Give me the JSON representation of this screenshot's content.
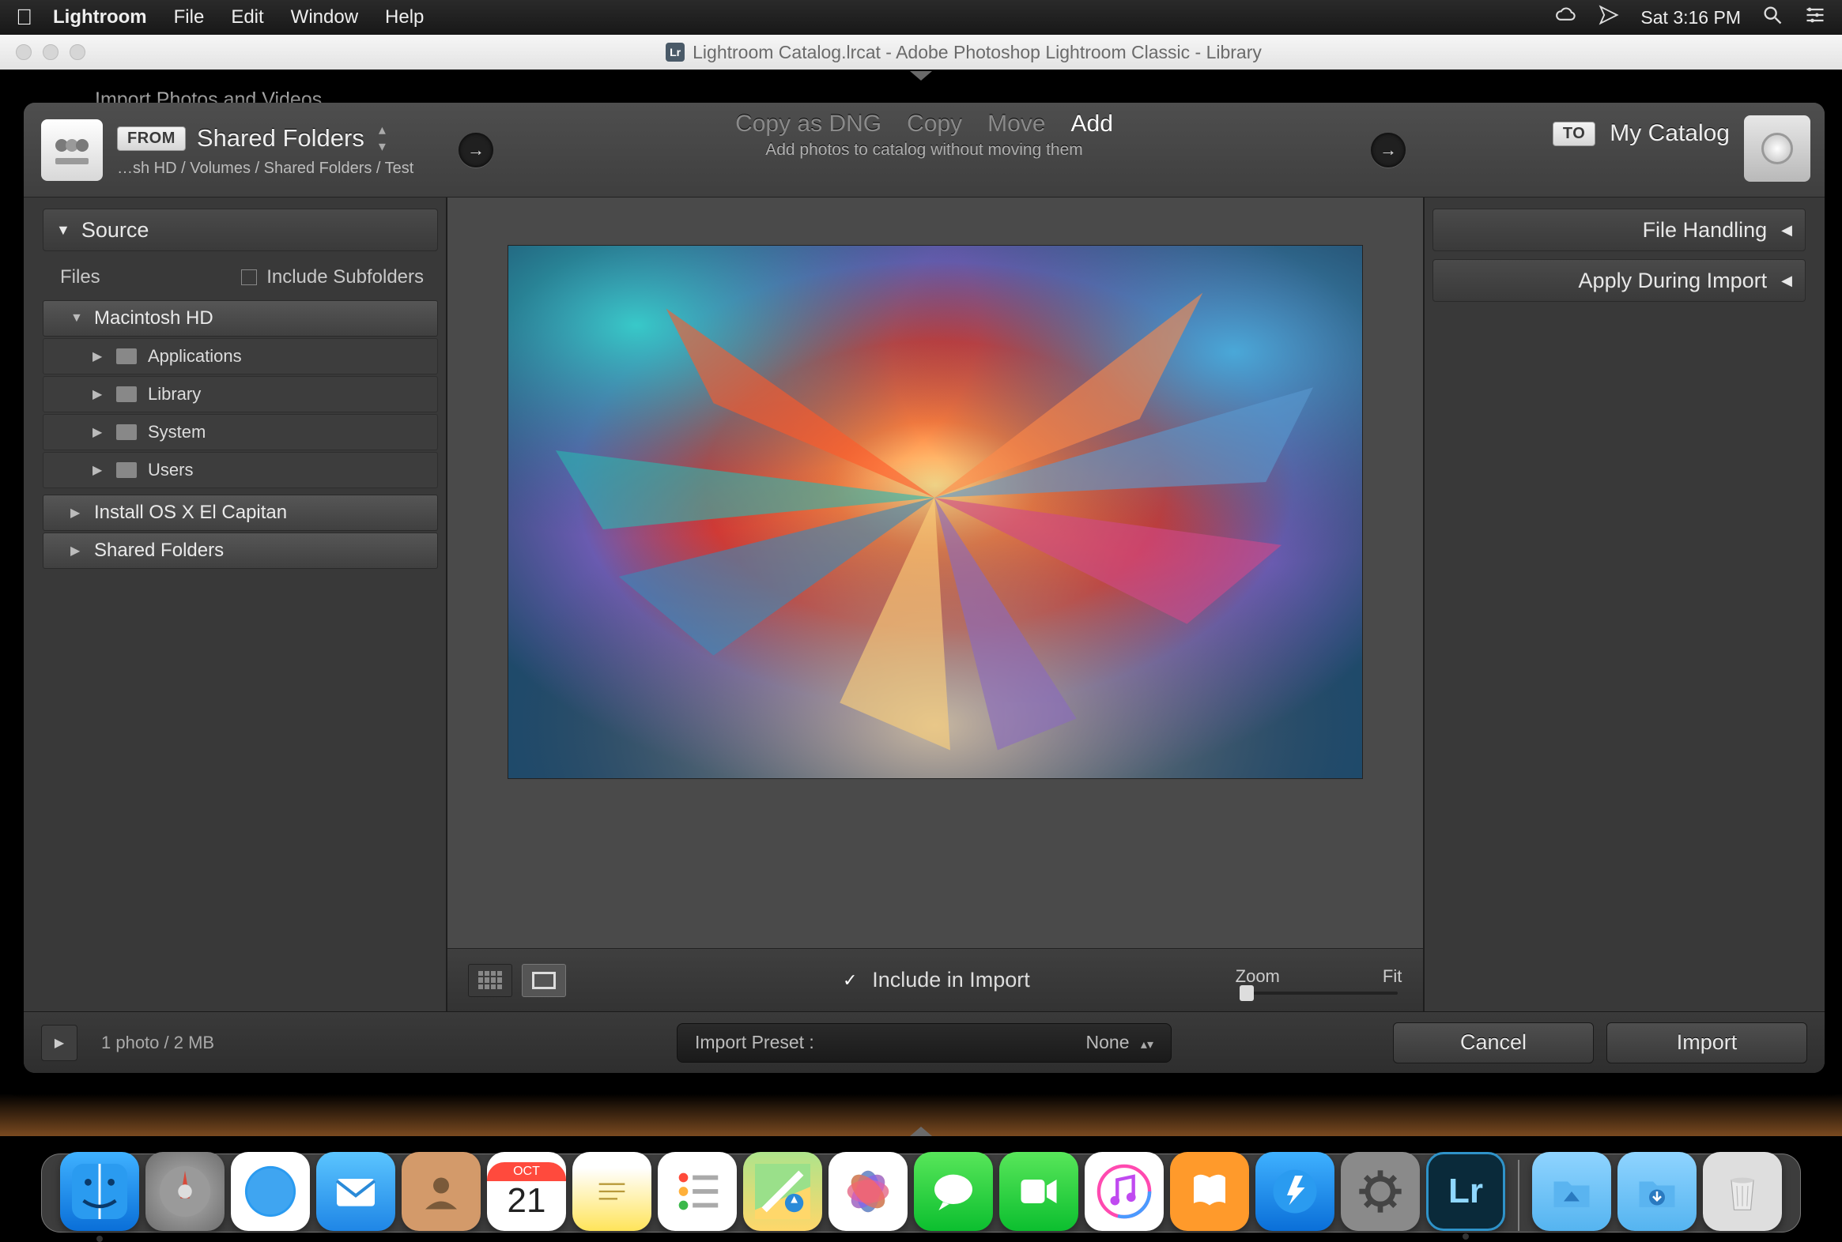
{
  "menubar": {
    "app": "Lightroom",
    "items": [
      "File",
      "Edit",
      "Window",
      "Help"
    ],
    "clock": "Sat 3:16 PM"
  },
  "titlebar": {
    "title": "Lightroom Catalog.lrcat - Adobe Photoshop Lightroom Classic - Library"
  },
  "hidden": "Import Photos and Videos",
  "import": {
    "from_badge": "FROM",
    "from_title": "Shared Folders",
    "from_path": "…sh HD / Volumes / Shared Folders / Test",
    "ops": [
      "Copy as DNG",
      "Copy",
      "Move",
      "Add"
    ],
    "op_active": "Add",
    "op_sub": "Add photos to catalog without moving them",
    "to_badge": "TO",
    "to_title": "My Catalog",
    "source_panel": "Source",
    "files_label": "Files",
    "include_subfolders": "Include Subfolders",
    "tree": {
      "root": "Macintosh HD",
      "children": [
        "Applications",
        "Library",
        "System",
        "Users"
      ],
      "siblings": [
        "Install OS X El Capitan",
        "Shared Folders"
      ]
    },
    "file_handling": "File Handling",
    "apply_during": "Apply During Import",
    "include_in_import": "Include in Import",
    "zoom_label": "Zoom",
    "fit_label": "Fit",
    "status": "1 photo / 2 MB",
    "preset_label": "Import Preset :",
    "preset_value": "None",
    "cancel": "Cancel",
    "import_btn": "Import"
  },
  "calendar": {
    "month": "OCT",
    "day": "21"
  },
  "dock": {
    "items": [
      {
        "name": "finder",
        "running": true
      },
      {
        "name": "launchpad",
        "running": false
      },
      {
        "name": "safari",
        "running": false
      },
      {
        "name": "mail",
        "running": false
      },
      {
        "name": "contacts",
        "running": false
      },
      {
        "name": "calendar",
        "running": false
      },
      {
        "name": "notes",
        "running": false
      },
      {
        "name": "reminders",
        "running": false
      },
      {
        "name": "maps",
        "running": false
      },
      {
        "name": "photos",
        "running": false
      },
      {
        "name": "messages",
        "running": false
      },
      {
        "name": "facetime",
        "running": false
      },
      {
        "name": "itunes",
        "running": false
      },
      {
        "name": "ibooks",
        "running": false
      },
      {
        "name": "appstore",
        "running": false
      },
      {
        "name": "systempreferences",
        "running": false
      },
      {
        "name": "lightroom",
        "running": true
      }
    ]
  }
}
